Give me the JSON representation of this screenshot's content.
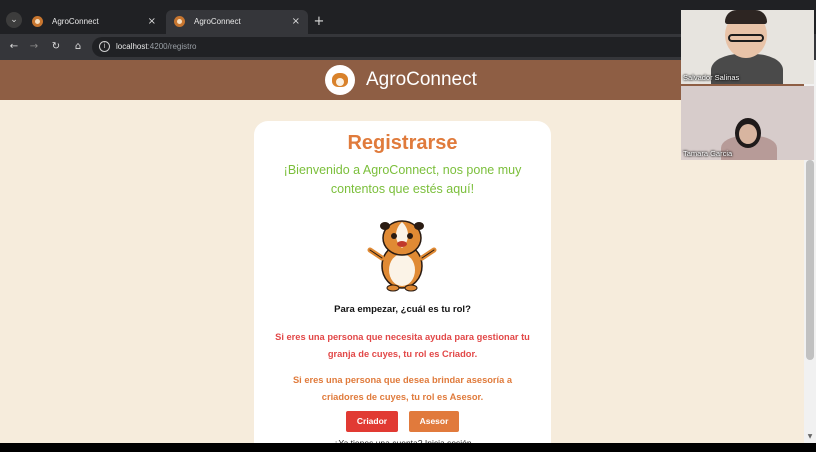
{
  "browser": {
    "tabs": [
      {
        "title": "AgroConnect",
        "close": "×"
      },
      {
        "title": "AgroConnect",
        "close": "×"
      }
    ],
    "new_tab": "+",
    "url_host": "localhost",
    "url_path": ":4200/registro",
    "nav": {
      "back": "←",
      "forward": "→",
      "reload": "↻",
      "home": "⌂",
      "tab_menu": "⌄",
      "site_info": "i"
    }
  },
  "header": {
    "brand": "AgroConnect"
  },
  "card": {
    "title": "Registrarse",
    "welcome": "¡Bienvenido a AgroConnect, nos pone muy contentos que estés aquí!",
    "role_question": "Para empezar, ¿cuál es tu rol?",
    "info_criador": "Si eres una persona que necesita ayuda para gestionar tu granja de cuyes, tu rol es Criador.",
    "info_asesor": "Si eres una persona que desea brindar asesoría a criadores de cuyes, tu rol es Asesor.",
    "buttons": {
      "criador": "Criador",
      "asesor": "Asesor"
    },
    "login_link": "¿Ya tienes una cuenta? Inicia sesión"
  },
  "video_call": {
    "participants": [
      {
        "name": "Salvador Salinas"
      },
      {
        "name": "Tamara Garcia"
      }
    ]
  },
  "colors": {
    "header": "#8e5e44",
    "page_bg": "#f6ecdc",
    "title": "#e07b3c",
    "welcome": "#7bbf3b",
    "criador": "#e13a33",
    "asesor": "#e17a3c"
  }
}
